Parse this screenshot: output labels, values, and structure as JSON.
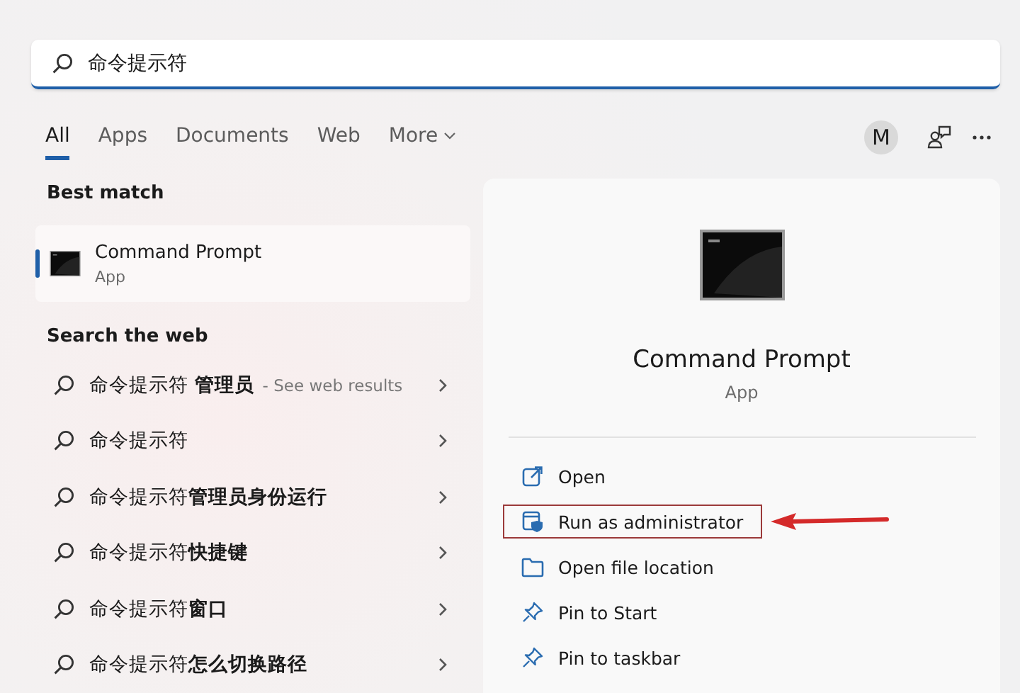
{
  "search": {
    "value": "命令提示符"
  },
  "tabs": [
    {
      "label": "All",
      "selected": true
    },
    {
      "label": "Apps",
      "selected": false
    },
    {
      "label": "Documents",
      "selected": false
    },
    {
      "label": "Web",
      "selected": false
    },
    {
      "label": "More",
      "selected": false,
      "kind": "dropdown"
    }
  ],
  "account": {
    "initial": "M"
  },
  "best_match": {
    "heading": "Best match",
    "name": "Command Prompt",
    "type": "App",
    "selected": true
  },
  "web": {
    "heading": "Search the web",
    "results": [
      {
        "text": "命令提示符 **管理员**",
        "hint": "- See web results"
      },
      {
        "text": "命令提示符"
      },
      {
        "text": "命令提示符**管理员身份运行**"
      },
      {
        "text": "命令提示符**快捷键**"
      },
      {
        "text": "命令提示符**窗口**"
      },
      {
        "text": "命令提示符**怎么切换路径**"
      }
    ]
  },
  "detail": {
    "name": "Command Prompt",
    "type": "App",
    "actions": [
      {
        "label": "Open",
        "kind": "open",
        "highlighted": false
      },
      {
        "label": "Run as administrator",
        "kind": "admin",
        "highlighted": true
      },
      {
        "label": "Open file location",
        "kind": "folder",
        "highlighted": false
      },
      {
        "label": "Pin to Start",
        "kind": "pin",
        "highlighted": false
      },
      {
        "label": "Pin to taskbar",
        "kind": "pin",
        "highlighted": false
      }
    ]
  }
}
